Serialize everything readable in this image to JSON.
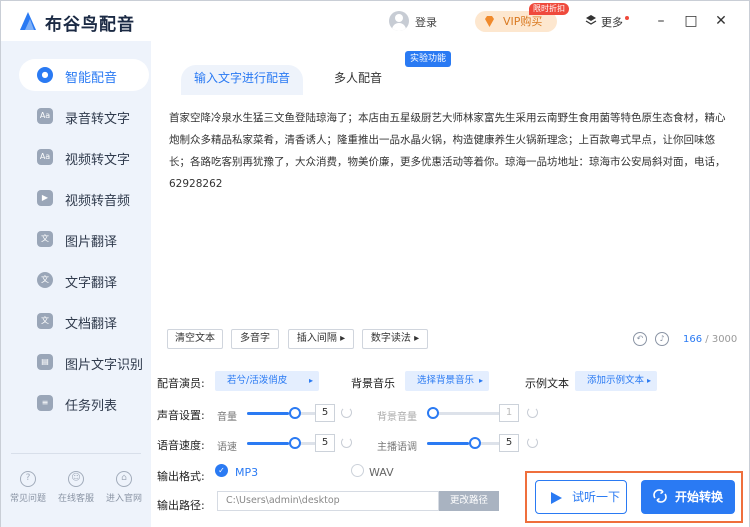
{
  "app": {
    "title": "布谷鸟配音"
  },
  "header": {
    "login": "登录",
    "vip_label": "VIP购买",
    "vip_badge": "限时折扣",
    "more_label": "更多",
    "min_glyph": "–",
    "max_glyph": "□",
    "close_glyph": "✕"
  },
  "sidebar": {
    "items": [
      {
        "label": "智能配音",
        "icon": "mic-icon",
        "active": true
      },
      {
        "label": "录音转文字",
        "icon": "audio-to-text-icon"
      },
      {
        "label": "视频转文字",
        "icon": "video-to-text-icon"
      },
      {
        "label": "视频转音频",
        "icon": "video-to-audio-icon"
      },
      {
        "label": "图片翻译",
        "icon": "image-translate-icon"
      },
      {
        "label": "文字翻译",
        "icon": "text-translate-icon"
      },
      {
        "label": "文档翻译",
        "icon": "doc-translate-icon"
      },
      {
        "label": "图片文字识别",
        "icon": "ocr-icon"
      },
      {
        "label": "任务列表",
        "icon": "task-list-icon"
      }
    ],
    "footer": [
      {
        "label": "常见问题",
        "icon": "help-icon"
      },
      {
        "label": "在线客服",
        "icon": "support-icon"
      },
      {
        "label": "进入官网",
        "icon": "website-icon"
      }
    ]
  },
  "tabs": [
    {
      "label": "输入文字进行配音",
      "active": true
    },
    {
      "label": "多人配音"
    }
  ],
  "exp_badge": "实验功能",
  "editor": {
    "text": "首家空降冷泉水生猛三文鱼登陆琼海了；本店由五星级厨艺大师林家富先生采用云南野生食用菌等特色原生态食材，精心炮制众多精品私家菜肴，清香诱人；隆重推出一品水晶火锅，构造健康养生火锅新理念；上百款粤式早点，让你回味悠长；各路吃客别再犹豫了，大众消费，物美价廉，更多优惠活动等着你。琼海一品坊地址：琼海市公安局斜对面，电话，62928262",
    "char_count": "166",
    "char_limit": "/ 3000",
    "toolbar": {
      "clear": "清空文本",
      "polyphone": "多音字",
      "insert_pause": "插入间隔",
      "number_reading": "数字读法"
    }
  },
  "settings": {
    "voice_label": "配音演员:",
    "voice_value": "若兮/活泼俏皮",
    "bgm_label": "背景音乐",
    "bgm_value": "选择背景音乐",
    "sample_label": "示例文本",
    "sample_value": "添加示例文本",
    "sound_label": "声音设置:",
    "volume_label": "音量",
    "volume_value": "5",
    "volume_level": 0.5,
    "bg_volume_label": "背景音量",
    "bg_volume_value": "1",
    "bg_volume_level": 0.0,
    "speed_section_label": "语音速度:",
    "speed_label": "语速",
    "speed_value": "5",
    "speed_level": 0.5,
    "pitch_label": "主播语调",
    "pitch_value": "5",
    "pitch_level": 0.5,
    "format_label": "输出格式:",
    "format_mp3": "MP3",
    "format_wav": "WAV",
    "path_label": "输出路径:",
    "path_value": "C:\\Users\\admin\\desktop",
    "path_button": "更改路径"
  },
  "actions": {
    "preview": "试听一下",
    "convert": "开始转换"
  },
  "colors": {
    "accent": "#2a7af3",
    "sidebar_bg": "#eef3fb",
    "highlight_border": "#ef6f3c",
    "vip_bg": "#fde7cf"
  }
}
